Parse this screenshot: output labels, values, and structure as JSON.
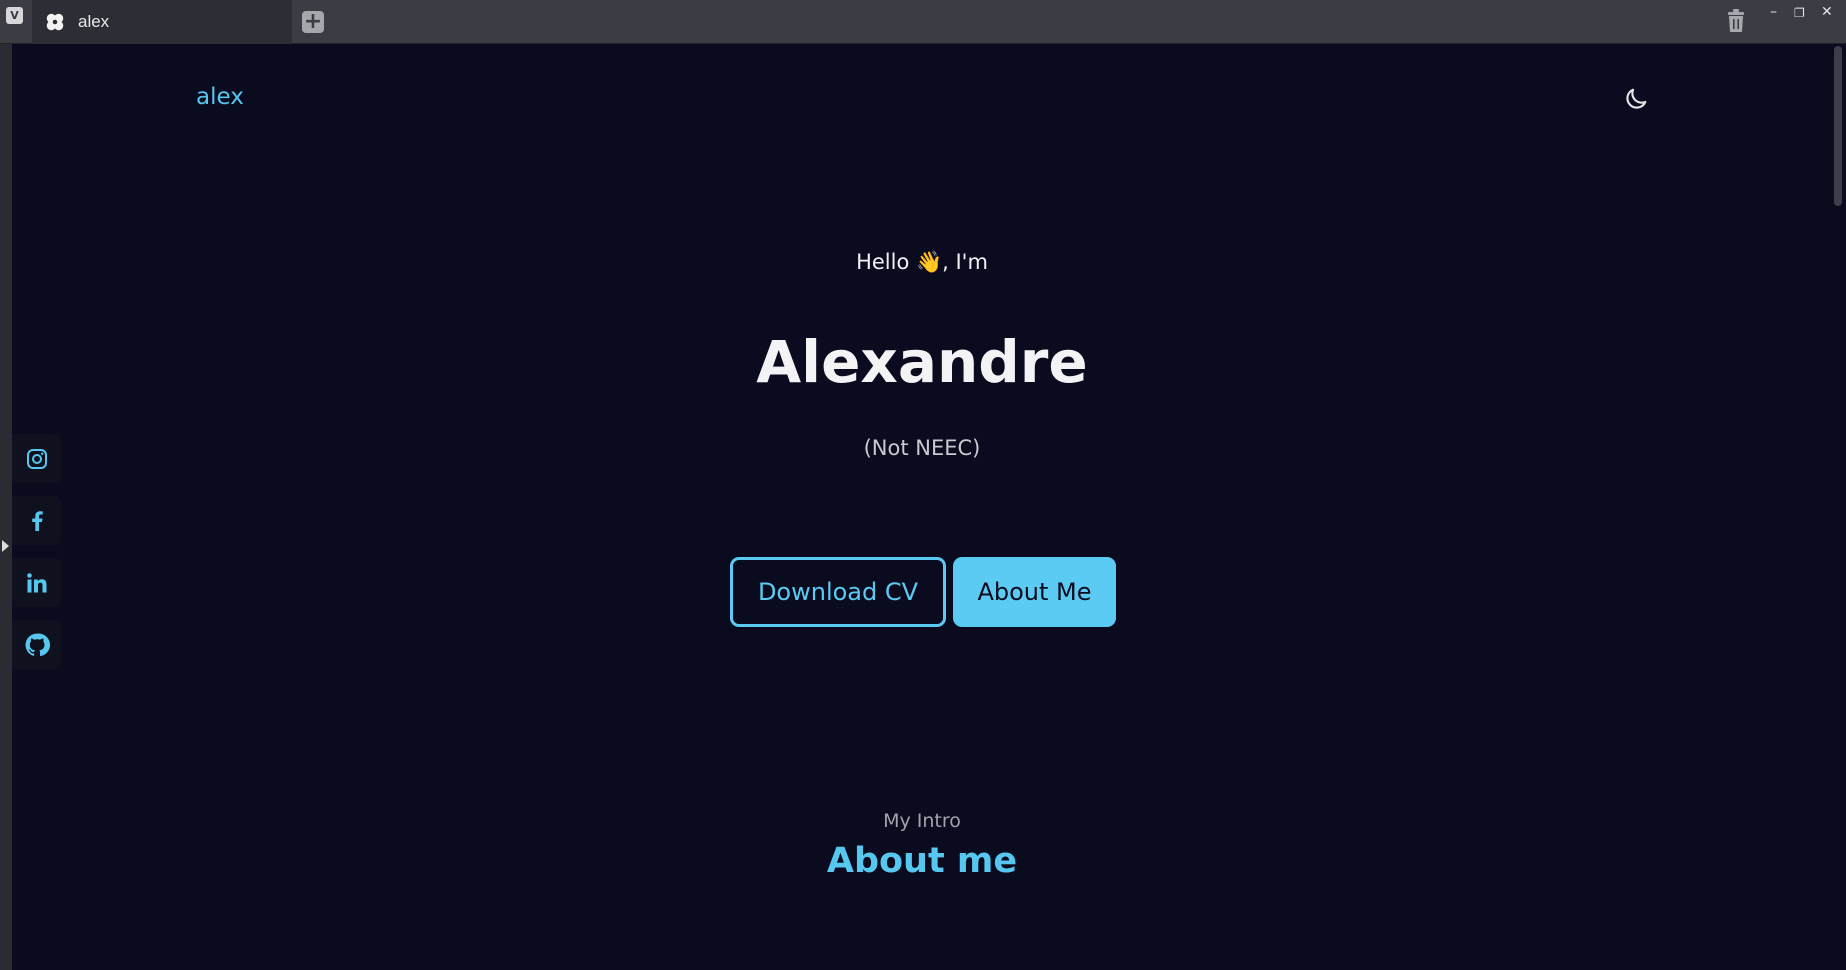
{
  "browser": {
    "tab_title": "alex",
    "new_tab_label": "+",
    "vivaldi_label": "V",
    "minimize_label": "–",
    "restore_label": "❐",
    "close_label": "✕"
  },
  "nav": {
    "logo": "alex",
    "theme_icon": "moon-icon"
  },
  "hero": {
    "greeting": "Hello 👋, I'm",
    "name": "Alexandre",
    "subtitle": "(Not NEEC)",
    "download_cv_label": "Download CV",
    "about_me_label": "About Me"
  },
  "social": [
    {
      "icon": "instagram-icon"
    },
    {
      "icon": "facebook-icon"
    },
    {
      "icon": "linkedin-icon"
    },
    {
      "icon": "github-icon"
    }
  ],
  "about": {
    "overline": "My Intro",
    "title": "About me"
  },
  "colors": {
    "background": "#0b0b1f",
    "accent": "#5ccbf3",
    "text": "#f1f1f4"
  }
}
